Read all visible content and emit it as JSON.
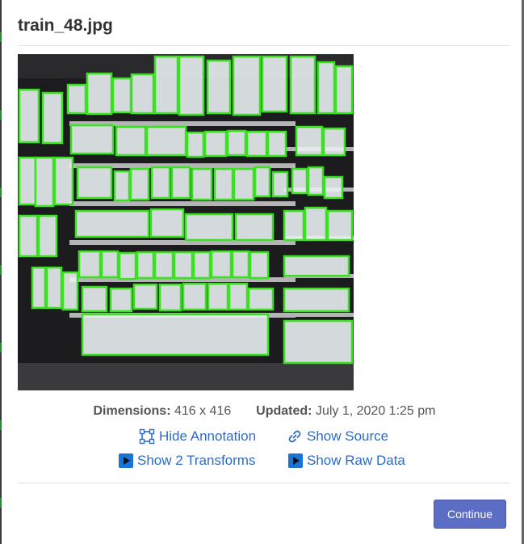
{
  "dialog": {
    "title": "train_48.jpg",
    "image": {
      "alt": "shelf image with product annotation boxes",
      "annotation_color": "#39e21f"
    },
    "meta": {
      "dimensions_label": "Dimensions:",
      "dimensions_value": "416 x 416",
      "updated_label": "Updated:",
      "updated_value": "July 1, 2020 1:25 pm"
    },
    "actions": {
      "hide_annotation": "Hide Annotation",
      "show_source": "Show Source",
      "show_transforms": "Show 2 Transforms",
      "show_raw_data": "Show Raw Data"
    },
    "continue_label": "Continue"
  },
  "colors": {
    "link": "#2f6bc4",
    "button": "#5b6dc4",
    "accent_icon": "#1a73d6"
  }
}
